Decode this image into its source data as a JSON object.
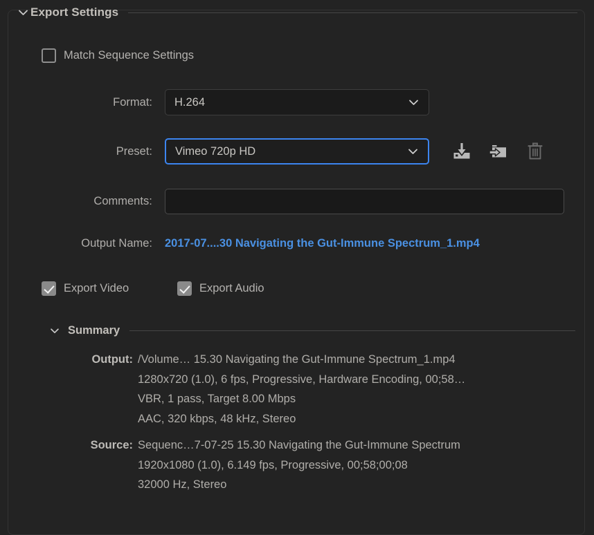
{
  "panel": {
    "section_title": "Export Settings",
    "twisty_icon": "chevron-down-icon"
  },
  "match_sequence": {
    "label": "Match Sequence Settings",
    "checked": false
  },
  "format": {
    "label": "Format:",
    "value": "H.264",
    "chevron_icon": "chevron-down-icon"
  },
  "preset": {
    "label": "Preset:",
    "value": "Vimeo 720p HD",
    "chevron_icon": "chevron-down-icon",
    "focus_color": "#3c85f0",
    "buttons": [
      {
        "name": "import-preset-icon",
        "title": "Import Preset",
        "enabled": true
      },
      {
        "name": "export-preset-icon",
        "title": "Export Preset",
        "enabled": true
      },
      {
        "name": "delete-preset-icon",
        "title": "Delete Preset",
        "enabled": false
      }
    ]
  },
  "comments": {
    "label": "Comments:",
    "value": "",
    "placeholder": ""
  },
  "output_name": {
    "label": "Output Name:",
    "value": "2017-07....30 Navigating the Gut-Immune Spectrum_1.mp4",
    "link_color": "#4a90e2"
  },
  "export_video": {
    "label": "Export Video",
    "checked": true
  },
  "export_audio": {
    "label": "Export Audio",
    "checked": true
  },
  "summary": {
    "title": "Summary",
    "twisty_icon": "chevron-down-icon",
    "output": {
      "key": "Output:",
      "lines": [
        "/Volume… 15.30 Navigating the Gut-Immune Spectrum_1.mp4",
        "1280x720 (1.0), 6 fps, Progressive, Hardware Encoding, 00;58…",
        "VBR, 1 pass, Target 8.00 Mbps",
        "AAC, 320 kbps, 48 kHz, Stereo"
      ]
    },
    "source": {
      "key": "Source:",
      "lines": [
        "Sequenc…7-07-25 15.30 Navigating the Gut-Immune Spectrum",
        "1920x1080 (1.0), 6.149 fps, Progressive, 00;58;00;08",
        "32000 Hz, Stereo"
      ]
    }
  }
}
